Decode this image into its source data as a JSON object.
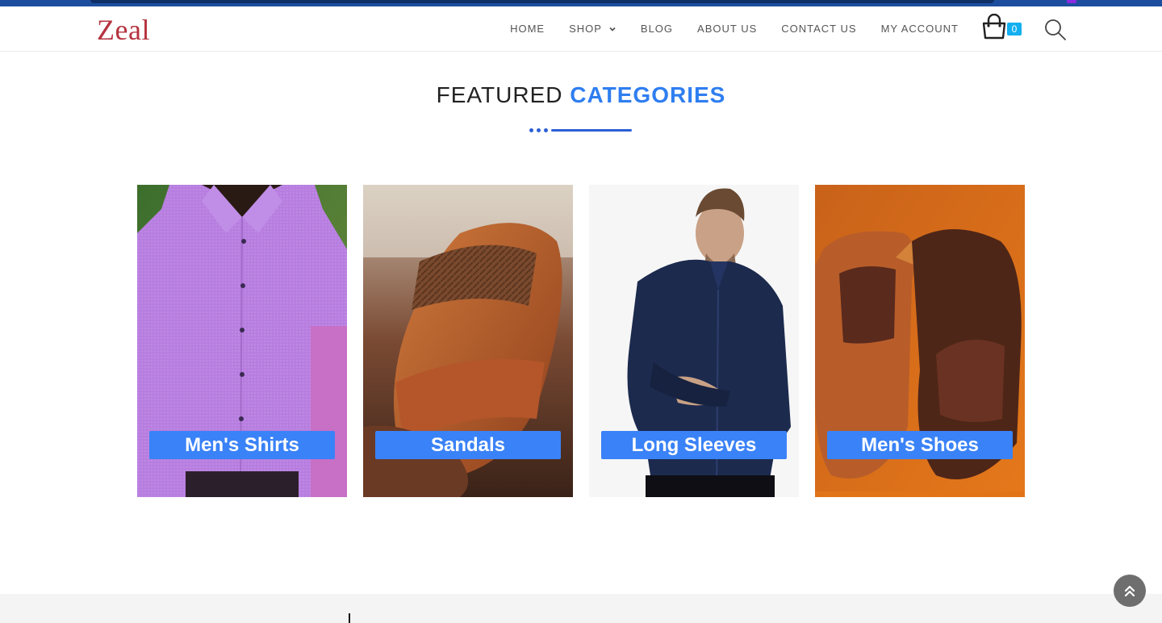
{
  "brand": {
    "logo_text": "Zeal"
  },
  "nav": {
    "items": [
      {
        "label": "HOME"
      },
      {
        "label": "SHOP"
      },
      {
        "label": "BLOG"
      },
      {
        "label": "ABOUT US"
      },
      {
        "label": "CONTACT US"
      },
      {
        "label": "MY ACCOUNT"
      }
    ]
  },
  "cart": {
    "count": "0"
  },
  "section": {
    "title_main": "FEATURED",
    "title_accent": "CATEGORIES"
  },
  "categories": [
    {
      "label": "Men's Shirts"
    },
    {
      "label": "Sandals"
    },
    {
      "label": "Long Sleeves"
    },
    {
      "label": "Men's Shoes"
    }
  ],
  "colors": {
    "accent": "#2f7ef0",
    "label_bg": "#3a82f7",
    "logo": "#b5333f",
    "cart_badge": "#13aff0",
    "topbar": "#1d4e9e"
  }
}
